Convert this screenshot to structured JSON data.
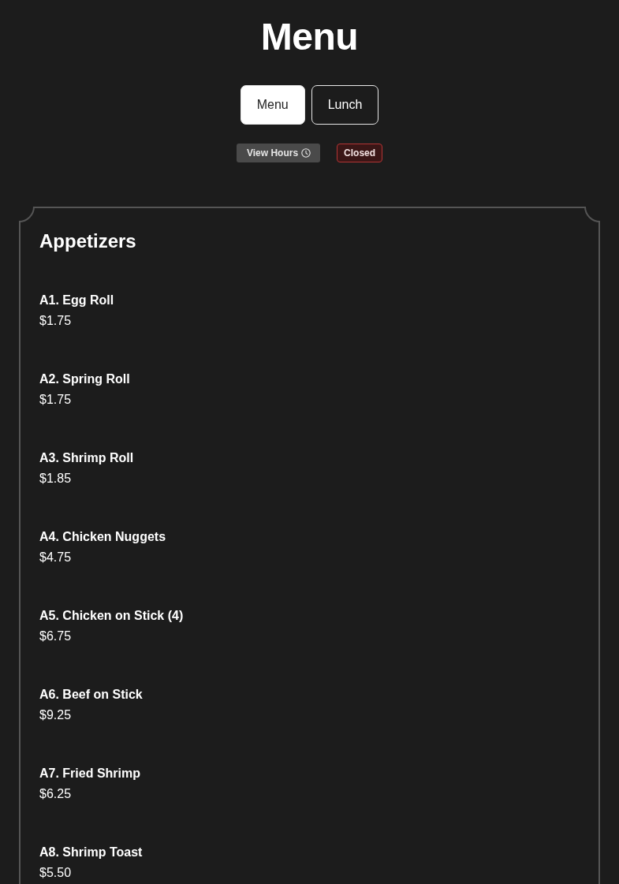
{
  "title": "Menu",
  "tabs": [
    {
      "label": "Menu",
      "selected": true
    },
    {
      "label": "Lunch",
      "selected": false
    }
  ],
  "hours_button": {
    "label": "View Hours"
  },
  "status_badge": {
    "label": "Closed",
    "open": false
  },
  "sections": [
    {
      "title": "Appetizers",
      "items": [
        {
          "name": "A1. Egg Roll",
          "price": "$1.75"
        },
        {
          "name": "A2. Spring Roll",
          "price": "$1.75"
        },
        {
          "name": "A3. Shrimp Roll",
          "price": "$1.85"
        },
        {
          "name": "A4. Chicken Nuggets",
          "price": "$4.75"
        },
        {
          "name": "A5. Chicken on Stick (4)",
          "price": "$6.75"
        },
        {
          "name": "A6. Beef on Stick",
          "price": "$9.25"
        },
        {
          "name": "A7. Fried Shrimp",
          "price": "$6.25"
        },
        {
          "name": "A8. Shrimp Toast",
          "price": "$5.50"
        }
      ]
    }
  ]
}
